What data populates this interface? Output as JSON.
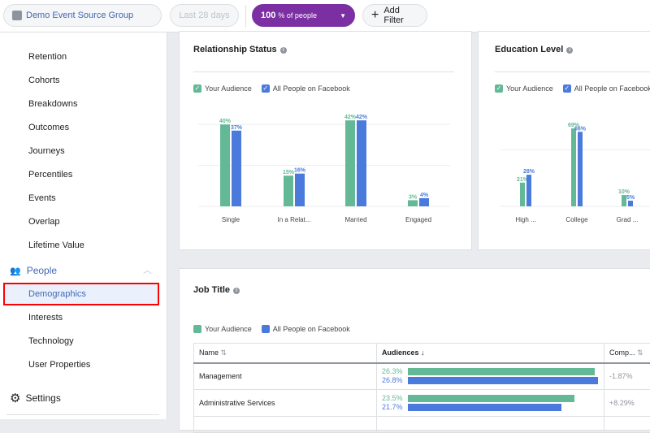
{
  "topbar": {
    "source_group": "Demo Event Source Group",
    "date_range": "Last 28 days",
    "people_value": "100",
    "people_suffix": "% of people",
    "add_filter": "Add Filter"
  },
  "sidebar": {
    "items": [
      "Retention",
      "Cohorts",
      "Breakdowns",
      "Outcomes",
      "Journeys",
      "Percentiles",
      "Events",
      "Overlap",
      "Lifetime Value"
    ],
    "section": "People",
    "sub_items": [
      "Demographics",
      "Interests",
      "Technology",
      "User Properties"
    ],
    "settings": "Settings",
    "active": "Demographics"
  },
  "legend": {
    "yours": "Your Audience",
    "all": "All People on Facebook"
  },
  "colors": {
    "yours": "#63b995",
    "all": "#4a7bdc",
    "accent": "#4267b2",
    "people_pill": "#7b2fa3",
    "highlight": "#ff0000"
  },
  "chart_data": [
    {
      "type": "bar",
      "title": "Relationship Status",
      "categories": [
        "Single",
        "In a Relat...",
        "Married",
        "Engaged"
      ],
      "series": [
        {
          "name": "Your Audience",
          "values": [
            40,
            15,
            42,
            3
          ]
        },
        {
          "name": "All People on Facebook",
          "values": [
            37,
            16,
            42,
            4
          ]
        }
      ],
      "ylim": [
        0,
        42
      ],
      "grid": true
    },
    {
      "type": "bar",
      "title": "Education Level",
      "categories": [
        "High ...",
        "College",
        "Grad ..."
      ],
      "series": [
        {
          "name": "Your Audience",
          "values": [
            21,
            69,
            10
          ]
        },
        {
          "name": "All People on Facebook",
          "values": [
            28,
            66,
            5
          ]
        }
      ],
      "ylim": [
        0,
        69
      ],
      "grid": true
    }
  ],
  "job_title": {
    "title": "Job Title",
    "columns": [
      "Name",
      "Audiences",
      "Comp..."
    ],
    "rows": [
      {
        "name": "Management",
        "yours": 26.3,
        "all": 26.8,
        "yours_label": "26.3%",
        "all_label": "26.8%",
        "comp": "-1.87%"
      },
      {
        "name": "Administrative Services",
        "yours": 23.5,
        "all": 21.7,
        "yours_label": "23.5%",
        "all_label": "21.7%",
        "comp": "+8.29%"
      }
    ]
  }
}
